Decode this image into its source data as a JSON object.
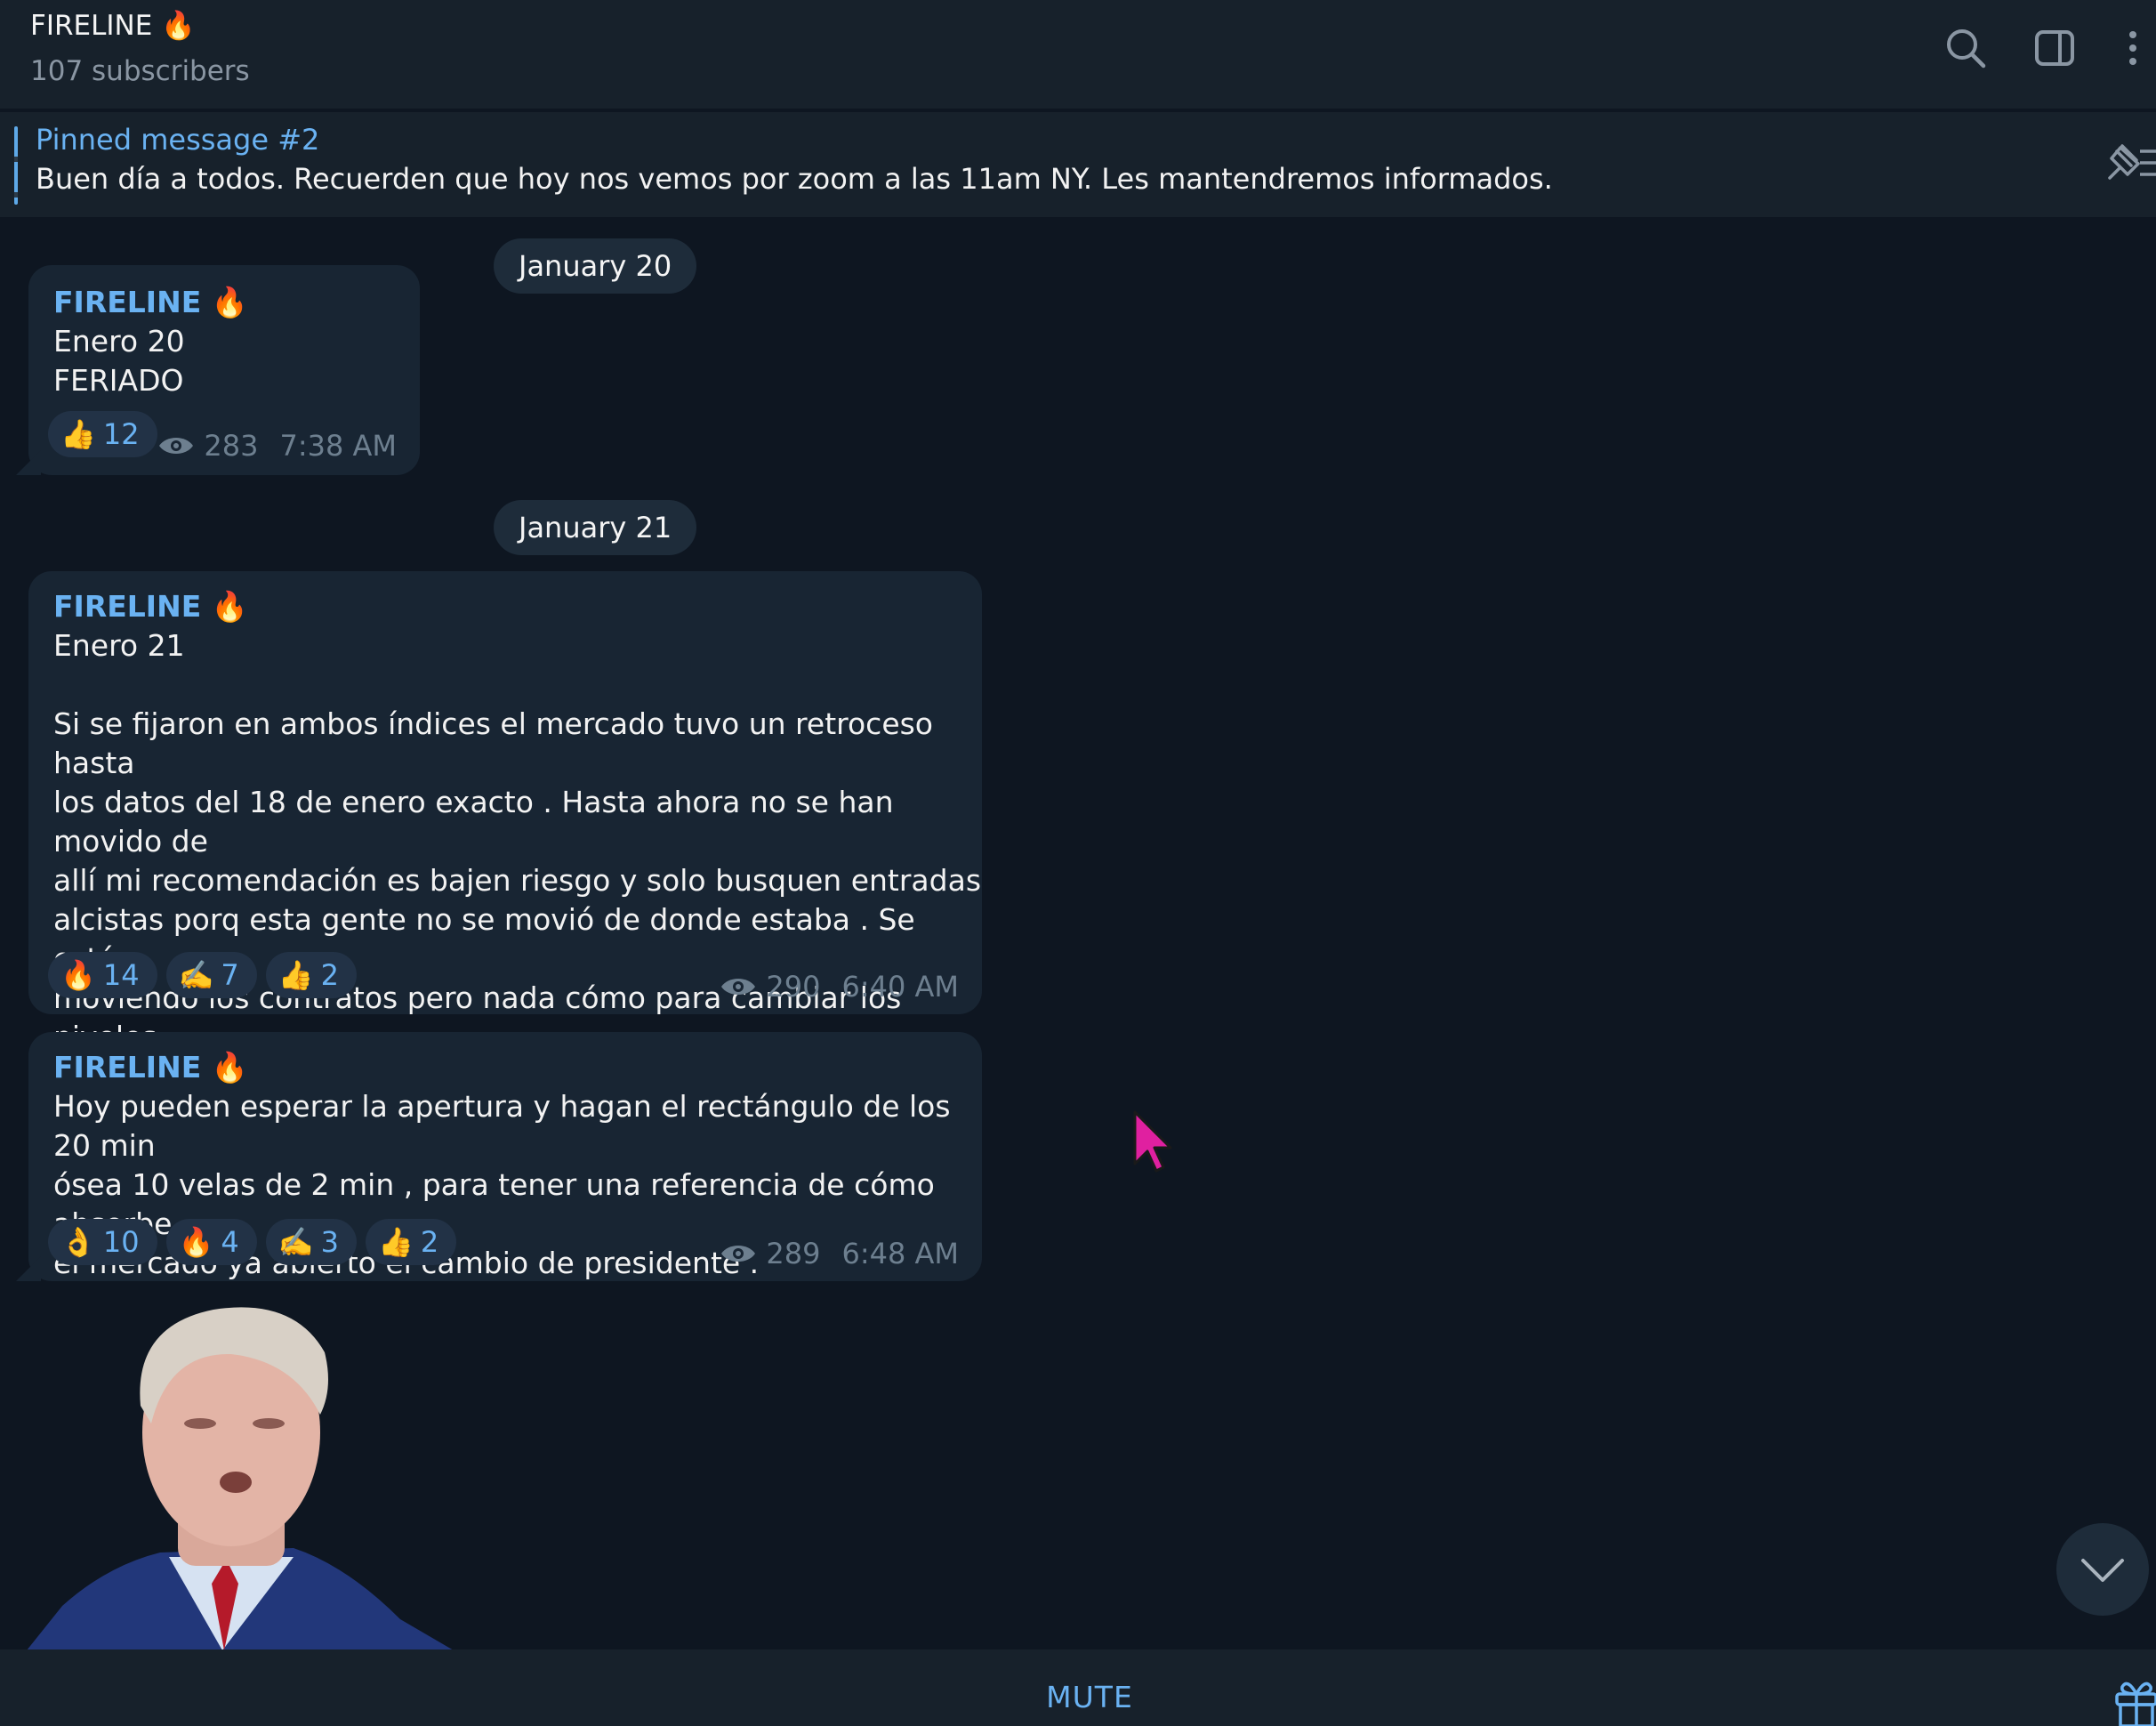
{
  "header": {
    "title": "FIRELINE 🔥",
    "subtitle": "107 subscribers"
  },
  "pinned": {
    "title": "Pinned message #2",
    "text": "Buen día a todos. Recuerden que hoy nos vemos por zoom a las 11am NY. Les mantendremos informados."
  },
  "dates": [
    "January 20",
    "January 21"
  ],
  "messages": [
    {
      "author": "FIRELINE 🔥",
      "text": "Enero 20\nFERIADO",
      "reactions": [
        {
          "emoji": "👍",
          "count": "12"
        }
      ],
      "views": "283",
      "time": "7:38 AM"
    },
    {
      "author": "FIRELINE 🔥",
      "text": "Enero 21\n\nSi se fijaron en ambos índices el mercado tuvo un retroceso hasta\nlos datos del 18 de enero exacto . Hasta ahora no se han movido de\nallí mi recomendación es bajen riesgo y solo busquen entradas\nalcistas porq esta gente no se movió de donde estaba . Se están\nmoviendo los contratos pero nada cómo para cambiar los niveles,\nestaré pendiente por si ocurre un cambio .",
      "reactions": [
        {
          "emoji": "🔥",
          "count": "14"
        },
        {
          "emoji": "✍️",
          "count": "7"
        },
        {
          "emoji": "👍",
          "count": "2"
        }
      ],
      "views": "290",
      "time": "6:40 AM"
    },
    {
      "author": "FIRELINE 🔥",
      "text": "Hoy pueden esperar la apertura y hagan el rectángulo de los 20 min\nósea 10 velas de 2 min , para tener una referencia de cómo absorbe\nel mercado ya abierto el cambio de presidente .",
      "reactions": [
        {
          "emoji": "👌",
          "count": "10"
        },
        {
          "emoji": "🔥",
          "count": "4"
        },
        {
          "emoji": "✍️",
          "count": "3"
        },
        {
          "emoji": "👍",
          "count": "2"
        }
      ],
      "views": "289",
      "time": "6:48 AM"
    }
  ],
  "bottom": {
    "mute_label": "MUTE"
  },
  "icons": {
    "search": "search-icon",
    "sidebar": "sidebar-toggle-icon",
    "more": "more-vertical-icon",
    "pin": "pin-list-icon",
    "eye": "eye-icon",
    "scroll": "chevron-down-icon",
    "gift": "gift-icon"
  },
  "colors": {
    "background": "#0e1621",
    "header": "#17212b",
    "bubble": "#182533",
    "accent": "#6ab2f2",
    "cursor": "#e020a0"
  }
}
